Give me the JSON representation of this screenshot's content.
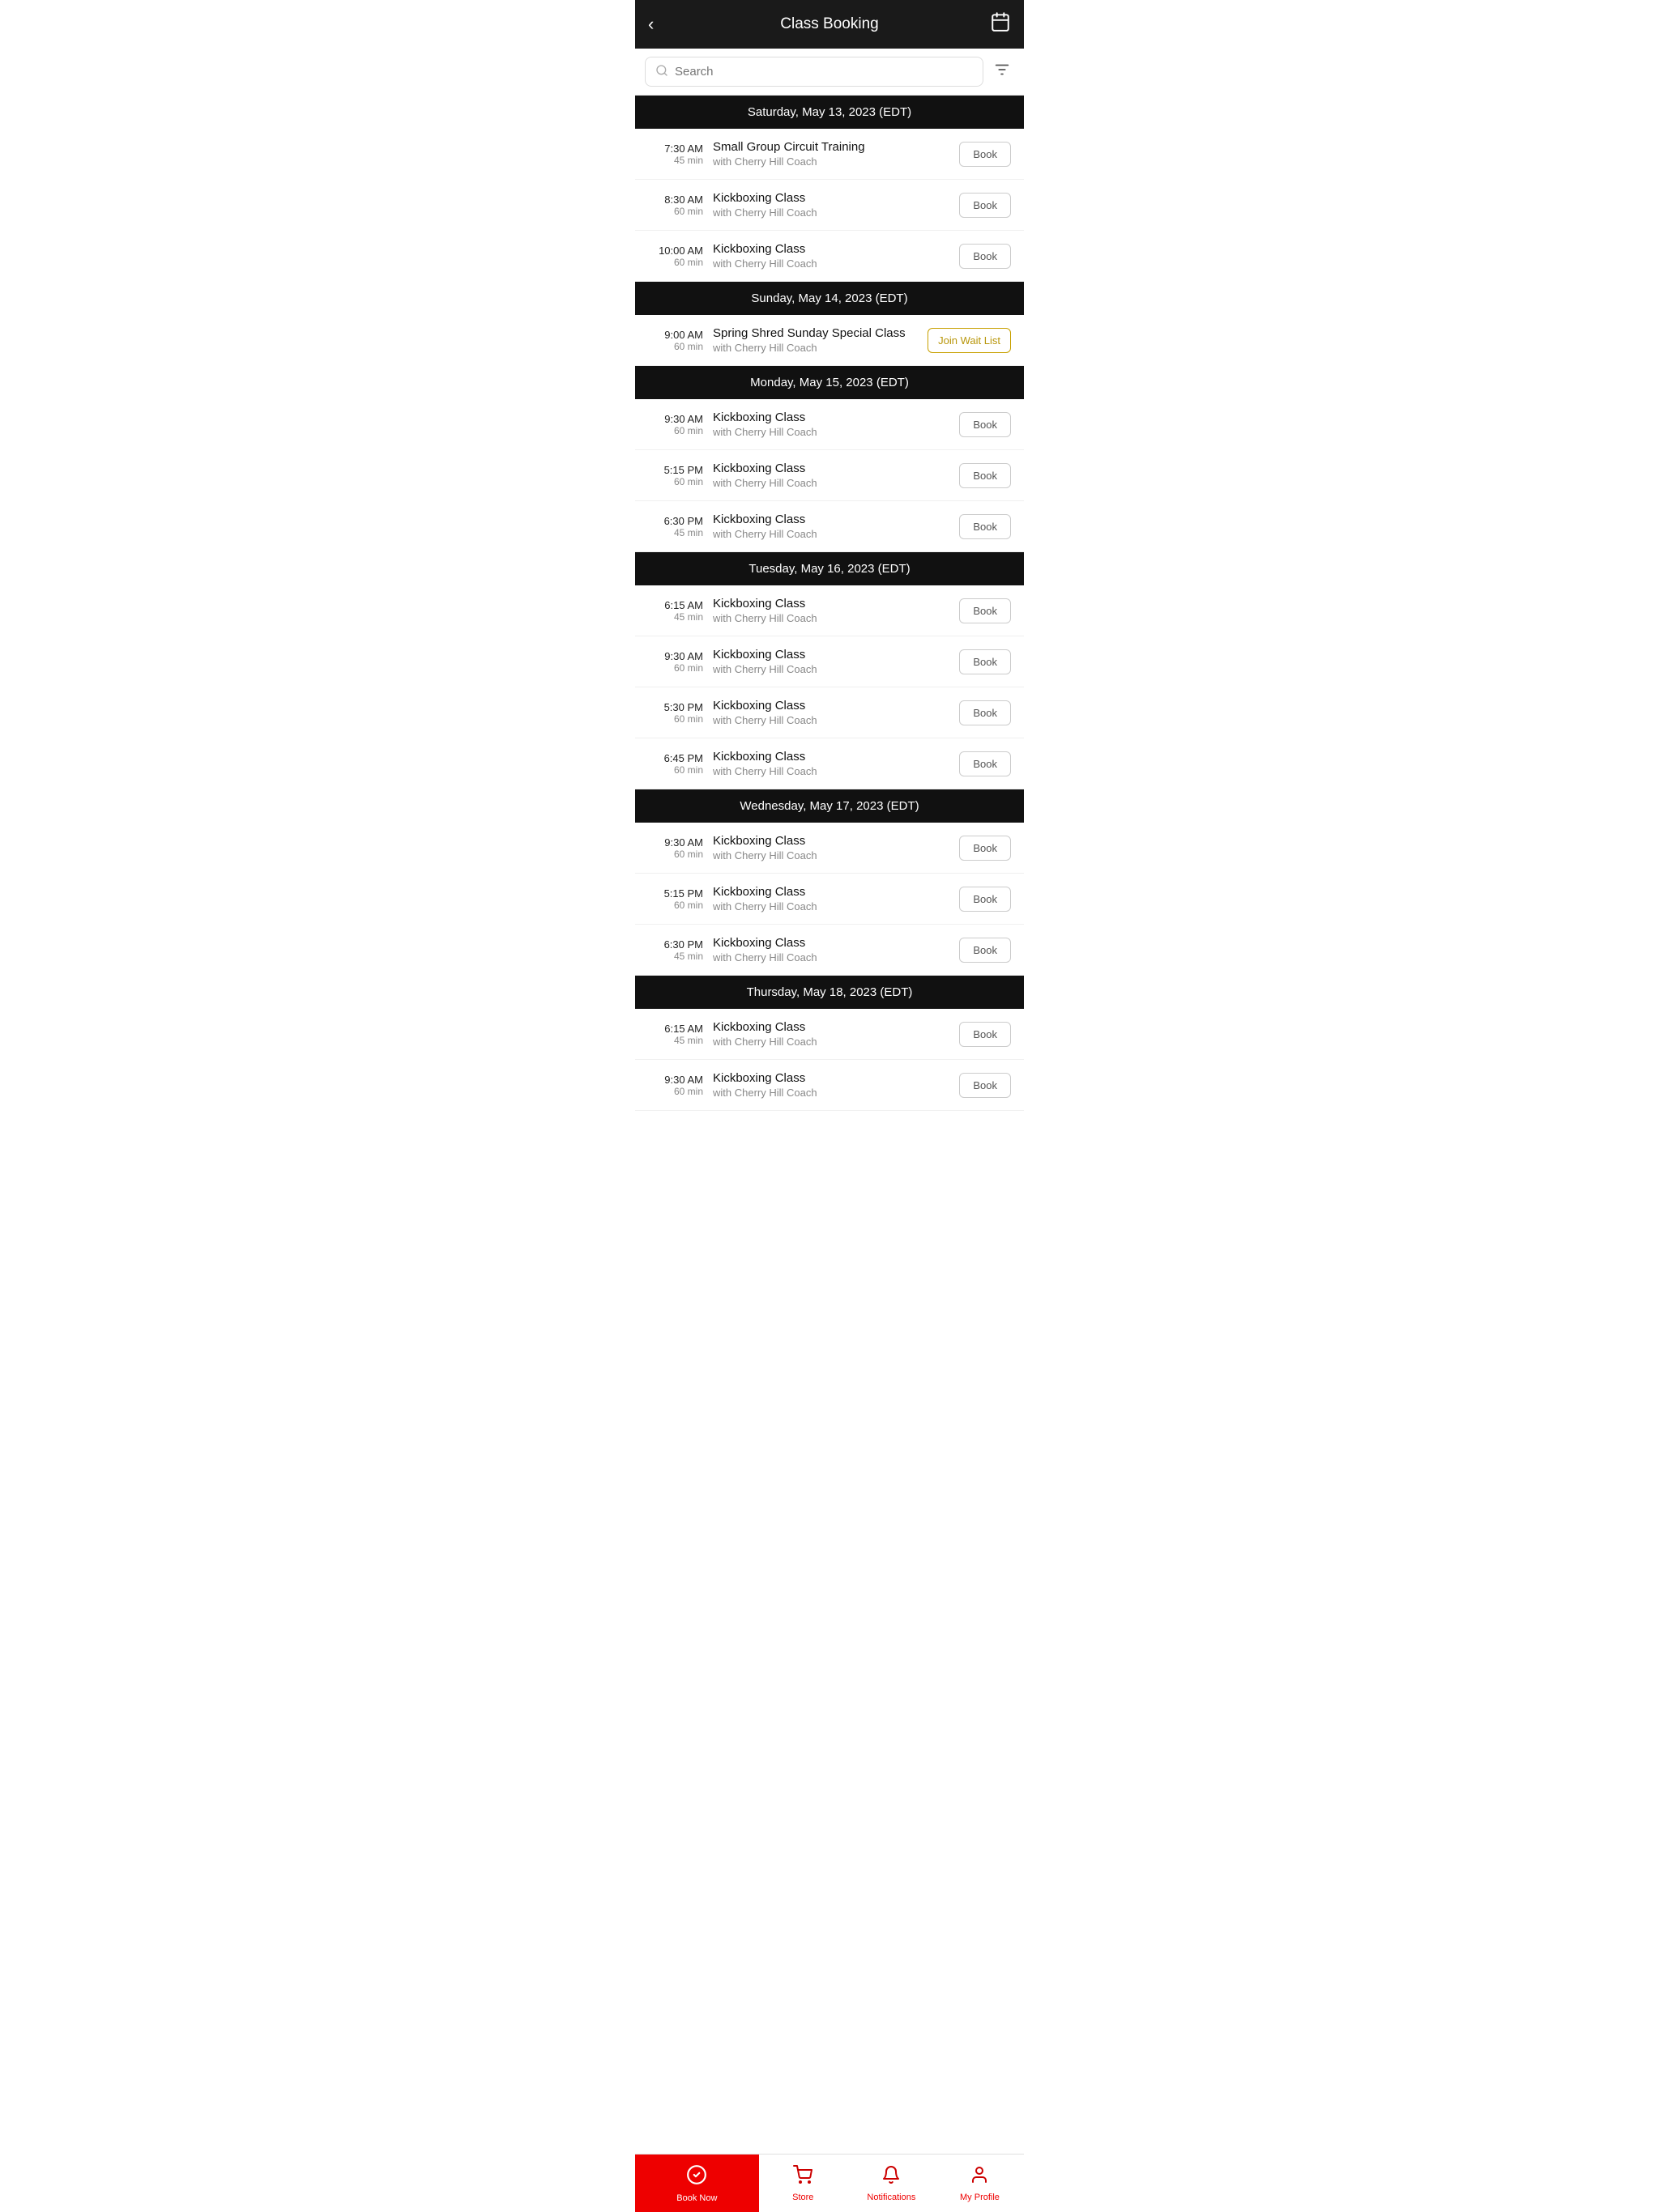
{
  "header": {
    "title": "Class Booking",
    "back_label": "‹",
    "calendar_icon": "📅"
  },
  "search": {
    "placeholder": "Search"
  },
  "schedule": [
    {
      "day": "Saturday, May 13, 2023 (EDT)",
      "classes": [
        {
          "time": "7:30 AM",
          "duration": "45 min",
          "name": "Small Group Circuit Training",
          "coach": "with Cherry Hill Coach",
          "button": "Book",
          "waitlist": false
        },
        {
          "time": "8:30 AM",
          "duration": "60 min",
          "name": "Kickboxing Class",
          "coach": "with Cherry Hill Coach",
          "button": "Book",
          "waitlist": false
        },
        {
          "time": "10:00 AM",
          "duration": "60 min",
          "name": "Kickboxing Class",
          "coach": "with Cherry Hill Coach",
          "button": "Book",
          "waitlist": false
        }
      ]
    },
    {
      "day": "Sunday, May 14, 2023 (EDT)",
      "classes": [
        {
          "time": "9:00 AM",
          "duration": "60 min",
          "name": "Spring Shred Sunday Special Class",
          "coach": "with Cherry Hill Coach",
          "button": "Join Wait List",
          "waitlist": true
        }
      ]
    },
    {
      "day": "Monday, May 15, 2023 (EDT)",
      "classes": [
        {
          "time": "9:30 AM",
          "duration": "60 min",
          "name": "Kickboxing Class",
          "coach": "with Cherry Hill Coach",
          "button": "Book",
          "waitlist": false
        },
        {
          "time": "5:15 PM",
          "duration": "60 min",
          "name": "Kickboxing Class",
          "coach": "with Cherry Hill Coach",
          "button": "Book",
          "waitlist": false
        },
        {
          "time": "6:30 PM",
          "duration": "45 min",
          "name": "Kickboxing Class",
          "coach": "with Cherry Hill Coach",
          "button": "Book",
          "waitlist": false
        }
      ]
    },
    {
      "day": "Tuesday, May 16, 2023 (EDT)",
      "classes": [
        {
          "time": "6:15 AM",
          "duration": "45 min",
          "name": "Kickboxing Class",
          "coach": "with Cherry Hill Coach",
          "button": "Book",
          "waitlist": false
        },
        {
          "time": "9:30 AM",
          "duration": "60 min",
          "name": "Kickboxing Class",
          "coach": "with Cherry Hill Coach",
          "button": "Book",
          "waitlist": false
        },
        {
          "time": "5:30 PM",
          "duration": "60 min",
          "name": "Kickboxing Class",
          "coach": "with Cherry Hill Coach",
          "button": "Book",
          "waitlist": false
        },
        {
          "time": "6:45 PM",
          "duration": "60 min",
          "name": "Kickboxing Class",
          "coach": "with Cherry Hill Coach",
          "button": "Book",
          "waitlist": false
        }
      ]
    },
    {
      "day": "Wednesday, May 17, 2023 (EDT)",
      "classes": [
        {
          "time": "9:30 AM",
          "duration": "60 min",
          "name": "Kickboxing Class",
          "coach": "with Cherry Hill Coach",
          "button": "Book",
          "waitlist": false
        },
        {
          "time": "5:15 PM",
          "duration": "60 min",
          "name": "Kickboxing Class",
          "coach": "with Cherry Hill Coach",
          "button": "Book",
          "waitlist": false
        },
        {
          "time": "6:30 PM",
          "duration": "45 min",
          "name": "Kickboxing Class",
          "coach": "with Cherry Hill Coach",
          "button": "Book",
          "waitlist": false
        }
      ]
    },
    {
      "day": "Thursday, May 18, 2023 (EDT)",
      "classes": [
        {
          "time": "6:15 AM",
          "duration": "45 min",
          "name": "Kickboxing Class",
          "coach": "with Cherry Hill Coach",
          "button": "Book",
          "waitlist": false
        },
        {
          "time": "9:30 AM",
          "duration": "60 min",
          "name": "Kickboxing Class",
          "coach": "with Cherry Hill Coach",
          "button": "Book",
          "waitlist": false
        }
      ]
    }
  ],
  "bottom_nav": {
    "book_now": "Book Now",
    "store": "Store",
    "notifications": "Notifications",
    "my_profile": "My Profile"
  }
}
